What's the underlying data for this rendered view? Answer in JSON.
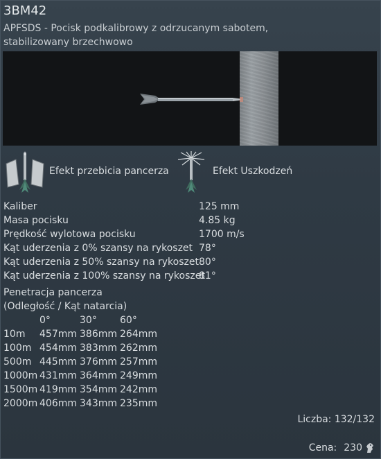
{
  "shell": {
    "title": "3BM42",
    "subtitle": "APFSDS - Pocisk podkalibrowy z odrzucanym sabotem, stabilizowany brzechwowo"
  },
  "effects": {
    "penetration_label": "Efekt przebicia pancerza",
    "damage_label": "Efekt Uszkodzeń"
  },
  "stats": [
    {
      "label": "Kaliber",
      "value": "125 mm"
    },
    {
      "label": "Masa pocisku",
      "value": "4.85 kg"
    },
    {
      "label": "Prędkość wylotowa pocisku",
      "value": "1700 m/s"
    },
    {
      "label": "Kąt uderzenia z 0% szansy na rykoszet",
      "value": "78°"
    },
    {
      "label": "Kąt uderzenia z 50% szansy na rykoszet",
      "value": "80°"
    },
    {
      "label": "Kąt uderzenia z 100% szansy na rykoszet",
      "value": "81°"
    }
  ],
  "penetration": {
    "title": "Penetracja pancerza",
    "subtitle": "(Odległość / Kąt natarcia)",
    "angles": [
      "0°",
      "30°",
      "60°"
    ],
    "rows": [
      {
        "distance": "10m",
        "values": [
          "457mm",
          "386mm",
          "264mm"
        ]
      },
      {
        "distance": "100m",
        "values": [
          "454mm",
          "383mm",
          "262mm"
        ]
      },
      {
        "distance": "500m",
        "values": [
          "445mm",
          "376mm",
          "257mm"
        ]
      },
      {
        "distance": "1000m",
        "values": [
          "431mm",
          "364mm",
          "249mm"
        ]
      },
      {
        "distance": "1500m",
        "values": [
          "419mm",
          "354mm",
          "242mm"
        ]
      },
      {
        "distance": "2000m",
        "values": [
          "406mm",
          "343mm",
          "235mm"
        ]
      }
    ]
  },
  "footer": {
    "count_label": "Liczba:",
    "count_value": "132/132",
    "price_label": "Cena:",
    "price_value": "230",
    "currency_icon": "silver-lion-icon"
  },
  "colors": {
    "background": "#2f3a44",
    "text": "#d9dde0",
    "preview_bg": "#121416"
  }
}
